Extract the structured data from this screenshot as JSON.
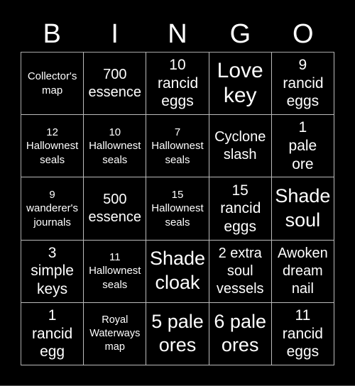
{
  "header": {
    "letters": [
      "B",
      "I",
      "N",
      "G",
      "O"
    ]
  },
  "cells": [
    [
      "Collector's map",
      "700 essence",
      "10 rancid eggs",
      "Love key",
      "9 rancid eggs"
    ],
    [
      "12 Hallownest seals",
      "10 Hallownest seals",
      "7 Hallownest seals",
      "Cyclone slash",
      "1 pale ore"
    ],
    [
      "9 wanderer's journals",
      "500 essence",
      "15 Hallownest seals",
      "15 rancid eggs",
      "Shade soul"
    ],
    [
      "3 simple keys",
      "11 Hallownest seals",
      "Shade cloak",
      "2 extra soul vessels",
      "Awoken dream nail"
    ],
    [
      "1 rancid egg",
      "Royal Waterways map",
      "5 pale ores",
      "6 pale ores",
      "11 rancid eggs"
    ]
  ],
  "colors": {
    "background": "#000000",
    "text": "#ffffff",
    "grid": "#bbbbbb"
  }
}
